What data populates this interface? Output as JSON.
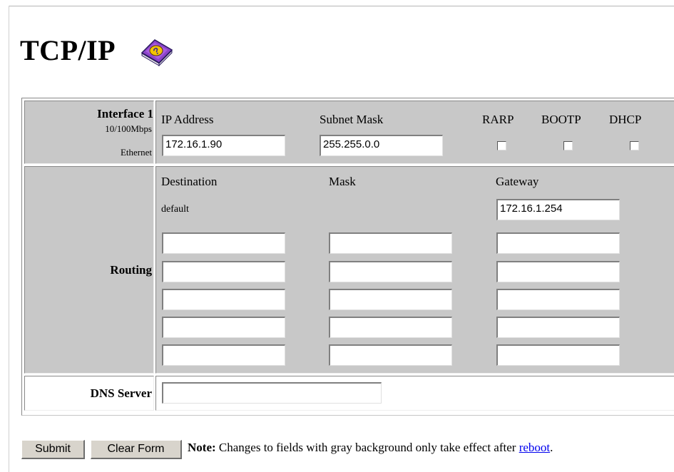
{
  "page": {
    "title": "TCP/IP",
    "help_icon": "help-book-icon"
  },
  "interface": {
    "name": "Interface 1",
    "speed": "10/100Mbps",
    "type": "Ethernet",
    "ip_label": "IP Address",
    "ip_value": "172.16.1.90",
    "mask_label": "Subnet Mask",
    "mask_value": "255.255.0.0",
    "rarp_label": "RARP",
    "bootp_label": "BOOTP",
    "dhcp_label": "DHCP"
  },
  "routing": {
    "label": "Routing",
    "dest_label": "Destination",
    "mask_label": "Mask",
    "gateway_label": "Gateway",
    "default_label": "default",
    "default_gateway": "172.16.1.254",
    "rows": [
      {
        "destination": "",
        "mask": "",
        "gateway": ""
      },
      {
        "destination": "",
        "mask": "",
        "gateway": ""
      },
      {
        "destination": "",
        "mask": "",
        "gateway": ""
      },
      {
        "destination": "",
        "mask": "",
        "gateway": ""
      },
      {
        "destination": "",
        "mask": "",
        "gateway": ""
      }
    ]
  },
  "dns": {
    "label": "DNS Server",
    "value": ""
  },
  "actions": {
    "submit_label": "Submit",
    "clear_label": "Clear Form",
    "note_bold": "Note:",
    "note_text": " Changes to fields with gray background only take effect after ",
    "reboot_link": "reboot",
    "note_end": "."
  }
}
